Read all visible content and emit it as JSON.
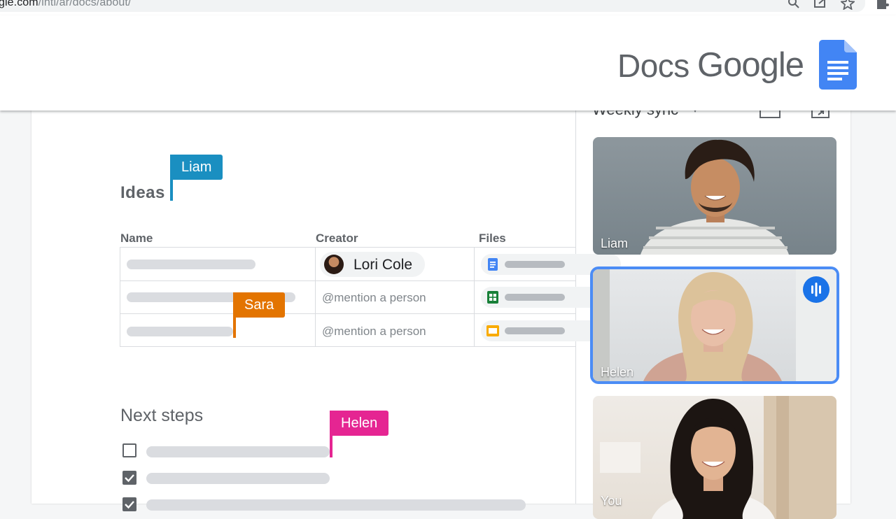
{
  "browser": {
    "url_host": "gle.com",
    "url_path": "/intl/ar/docs/about/"
  },
  "header": {
    "brand_product": "Docs",
    "brand_company": "Google",
    "logo_icon": "google-docs-icon"
  },
  "document": {
    "ideas_heading": "Ideas",
    "columns": [
      "Name",
      "Creator",
      "Files"
    ],
    "rows": [
      {
        "creator": "Lori Cole",
        "file_icon": "docs-file-icon"
      },
      {
        "creator": "@mention a person",
        "file_icon": "sheets-file-icon"
      },
      {
        "creator": "@mention a person",
        "file_icon": "slides-file-icon"
      }
    ],
    "next_steps_heading": "Next steps",
    "checklist": [
      {
        "checked": false
      },
      {
        "checked": true
      },
      {
        "checked": true
      }
    ]
  },
  "collaborators": [
    {
      "name": "Liam",
      "color": "#1a8fc1"
    },
    {
      "name": "Sara",
      "color": "#e37400"
    },
    {
      "name": "Helen",
      "color": "#e52592"
    }
  ],
  "meet": {
    "title": "Weekly sync",
    "participants": [
      {
        "name": "Liam",
        "speaking": false
      },
      {
        "name": "Helen",
        "speaking": true
      },
      {
        "name": "You",
        "speaking": false
      }
    ]
  },
  "colors": {
    "docs_blue": "#4285f4",
    "sheets_green": "#188038",
    "slides_yellow": "#f9ab00",
    "speaking_highlight": "#4b8cf5"
  }
}
